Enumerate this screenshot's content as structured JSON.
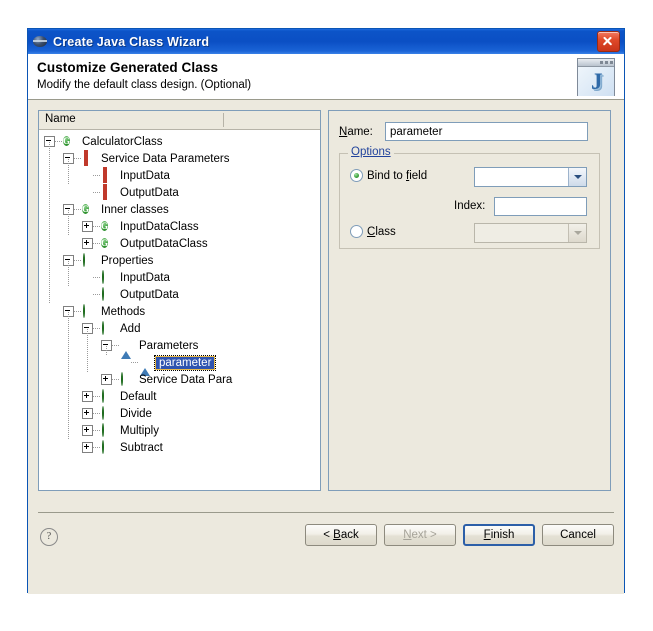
{
  "window": {
    "title": "Create Java Class Wizard",
    "title_icon": "eclipse-sphere-icon",
    "close_label": "Close"
  },
  "header": {
    "title": "Customize Generated Class",
    "subtitle": "Modify the default class design. (Optional)",
    "logo_glyph": "J"
  },
  "tree": {
    "column_header": "Name",
    "nodes": [
      {
        "label": "CalculatorClass",
        "depth": 0,
        "toggle": "minus",
        "icon": "green-circle-g-icon"
      },
      {
        "label": "Service Data Parameters",
        "depth": 1,
        "toggle": "minus",
        "icon": "red-square-icon"
      },
      {
        "label": "InputData",
        "depth": 2,
        "toggle": "none",
        "icon": "red-square-icon"
      },
      {
        "label": "OutputData",
        "depth": 2,
        "toggle": "none",
        "icon": "red-square-icon"
      },
      {
        "label": "Inner classes",
        "depth": 1,
        "toggle": "minus",
        "icon": "green-circle-g-icon"
      },
      {
        "label": "InputDataClass",
        "depth": 2,
        "toggle": "plus",
        "icon": "green-circle-g-icon"
      },
      {
        "label": "OutputDataClass",
        "depth": 2,
        "toggle": "plus",
        "icon": "green-circle-g-icon"
      },
      {
        "label": "Properties",
        "depth": 1,
        "toggle": "minus",
        "icon": "green-dot-icon"
      },
      {
        "label": "InputData",
        "depth": 2,
        "toggle": "none",
        "icon": "green-dot-icon"
      },
      {
        "label": "OutputData",
        "depth": 2,
        "toggle": "none",
        "icon": "green-dot-icon"
      },
      {
        "label": "Methods",
        "depth": 1,
        "toggle": "minus",
        "icon": "green-dot-icon"
      },
      {
        "label": "Add",
        "depth": 2,
        "toggle": "minus",
        "icon": "green-dot-icon"
      },
      {
        "label": "Parameters",
        "depth": 3,
        "toggle": "minus",
        "icon": "blue-triangle-icon"
      },
      {
        "label": "parameter",
        "depth": 4,
        "toggle": "none",
        "icon": "blue-triangle-icon",
        "selected": true
      },
      {
        "label": "Service Data Para",
        "depth": 3,
        "toggle": "plus",
        "icon": "green-dot-icon"
      },
      {
        "label": "Default",
        "depth": 2,
        "toggle": "plus",
        "icon": "green-dot-icon"
      },
      {
        "label": "Divide",
        "depth": 2,
        "toggle": "plus",
        "icon": "green-dot-icon"
      },
      {
        "label": "Multiply",
        "depth": 2,
        "toggle": "plus",
        "icon": "green-dot-icon"
      },
      {
        "label": "Subtract",
        "depth": 2,
        "toggle": "plus",
        "icon": "green-dot-icon"
      }
    ]
  },
  "details": {
    "name_label": "Name:",
    "name_value": "parameter",
    "name_placeholder": "",
    "options_legend": "Options",
    "bind_to_field_label": "Bind to field",
    "bind_to_field_selected": true,
    "bind_to_field_value": "",
    "index_label": "Index:",
    "index_value": "",
    "class_label": "Class",
    "class_selected": false,
    "class_value": "",
    "class_enabled": false
  },
  "footer": {
    "help_glyph": "?",
    "buttons": [
      {
        "label": "< Back",
        "state": "enabled"
      },
      {
        "label": "Next >",
        "state": "disabled"
      },
      {
        "label": "Finish",
        "state": "default"
      },
      {
        "label": "Cancel",
        "state": "enabled"
      }
    ]
  },
  "colors": {
    "titlebar": "#0B4FC4",
    "dialog_bg": "#ECE9DE",
    "panel_border": "#7f9db9",
    "selection": "#2F54B0",
    "accent_green": "#3ba13b",
    "accent_red": "#C0392B",
    "accent_blue": "#3F7BB6"
  }
}
